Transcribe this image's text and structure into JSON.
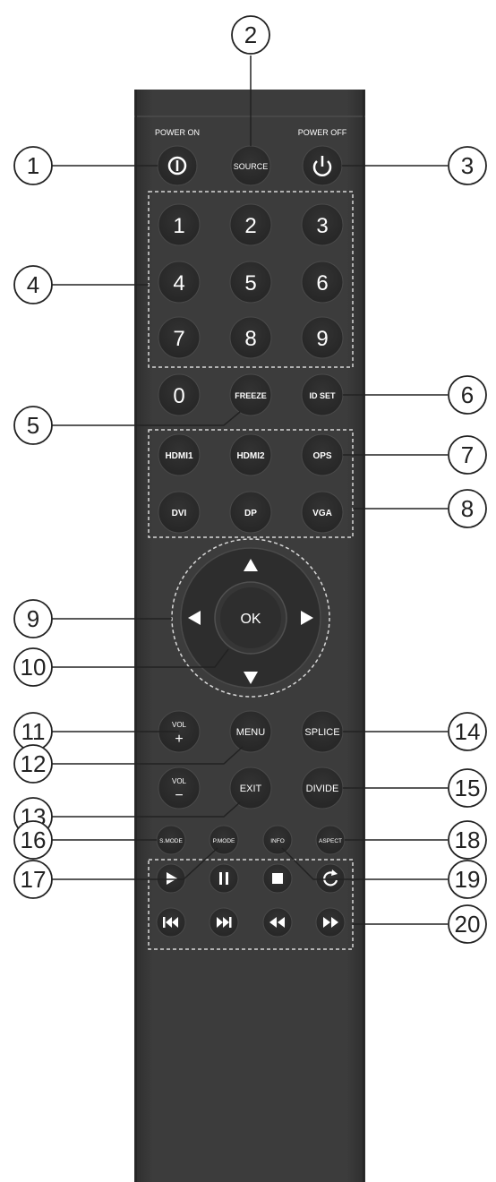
{
  "colors": {
    "body": "#3a3a3a",
    "body_edge": "#2c2c2c",
    "button": "#2b2b2b",
    "button_ring": "#4a4a4a",
    "label": "#ffffff",
    "callout": "#222222",
    "dashed": "#d8d8d8"
  },
  "top_labels": {
    "power_on": "POWER ON",
    "power_off": "POWER OFF"
  },
  "buttons": {
    "source": "SOURCE",
    "digits": [
      "1",
      "2",
      "3",
      "4",
      "5",
      "6",
      "7",
      "8",
      "9",
      "0"
    ],
    "freeze": "FREEZE",
    "id_set": "ID SET",
    "hdmi1": "HDMI1",
    "hdmi2": "HDMI2",
    "ops": "OPS",
    "dvi": "DVI",
    "dp": "DP",
    "vga": "VGA",
    "ok": "OK",
    "vol": "VOL",
    "vol_plus": "+",
    "vol_minus": "−",
    "menu": "MENU",
    "exit": "EXIT",
    "splice": "SPLICE",
    "divide": "DIVIDE",
    "s_mode": "S.MODE",
    "p_mode": "P.MODE",
    "info": "INFO",
    "aspect": "ASPECT"
  },
  "icons": {
    "power_on": "power-on-icon",
    "power_off": "power-off-icon",
    "arrows": [
      "arrow-up-icon",
      "arrow-left-icon",
      "arrow-right-icon",
      "arrow-down-icon"
    ],
    "media_row1": [
      "play-icon",
      "pause-icon",
      "stop-icon",
      "repeat-icon"
    ],
    "media_row2": [
      "previous-icon",
      "next-icon",
      "rewind-icon",
      "fast-forward-icon"
    ]
  },
  "callouts": [
    "1",
    "2",
    "3",
    "4",
    "5",
    "6",
    "7",
    "8",
    "9",
    "10",
    "11",
    "12",
    "13",
    "14",
    "15",
    "16",
    "17",
    "18",
    "19",
    "20"
  ]
}
